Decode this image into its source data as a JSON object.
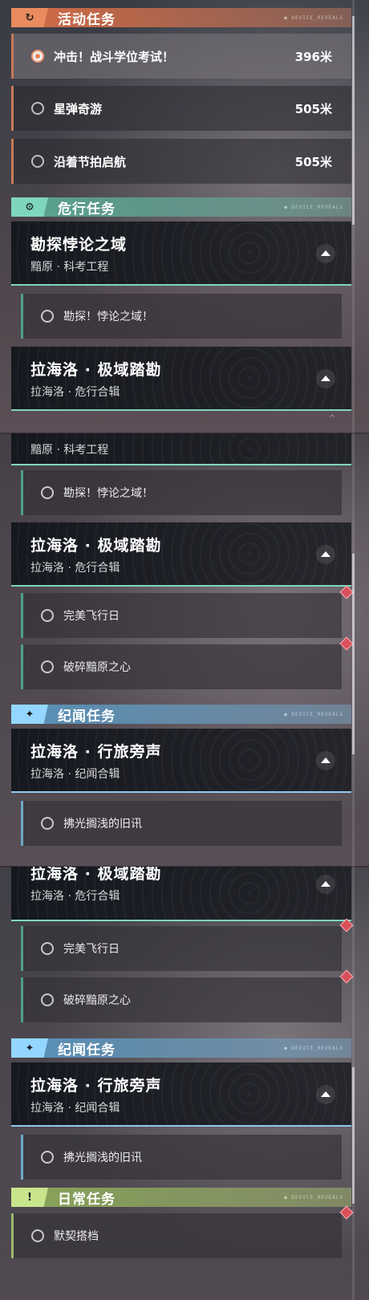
{
  "panel1": {
    "activity_header": {
      "title": "活动任务",
      "tag": "● DEVICE_REVEALS",
      "icon": "refresh-arrow-icon"
    },
    "activity_items": [
      {
        "label": "冲击！战斗学位考试！",
        "distance": "396米",
        "active": true
      },
      {
        "label": "星弹奇游",
        "distance": "505米",
        "active": false
      },
      {
        "label": "沿着节拍启航",
        "distance": "505米",
        "active": false
      }
    ],
    "danger_header": {
      "title": "危行任务",
      "tag": "● DEVICE_REVEALS",
      "icon": "gear-icon"
    },
    "card1": {
      "title": "勘探悖论之域",
      "subtitle": "黯原 · 科考工程"
    },
    "card1_sub": "勘探！悖论之域！",
    "card2": {
      "title": "拉海洛 · 极域踏勘",
      "subtitle": "拉海洛 · 危行合辑"
    },
    "scroll_hint": "^"
  },
  "panel2": {
    "card1_partial": {
      "subtitle": "黯原 · 科考工程"
    },
    "card1_sub": "勘探！悖论之域！",
    "card2": {
      "title": "拉海洛 · 极域踏勘",
      "subtitle": "拉海洛 · 危行合辑"
    },
    "card2_subs": [
      "完美飞行日",
      "破碎黯原之心"
    ],
    "story_header": {
      "title": "纪闻任务",
      "tag": "● DEVICE_REVEALS",
      "icon": "sparkle-icon"
    },
    "card3": {
      "title": "拉海洛 · 行旅旁声",
      "subtitle": "拉海洛 · 纪闻合辑"
    },
    "card3_sub": "拂光搁浅的旧讯"
  },
  "panel3": {
    "card2": {
      "title": "拉海洛 · 极域踏勘",
      "subtitle": "拉海洛 · 危行合辑"
    },
    "card2_subs": [
      "完美飞行日",
      "破碎黯原之心"
    ],
    "story_header": {
      "title": "纪闻任务",
      "tag": "● DEVICE_REVEALS",
      "icon": "sparkle-icon"
    },
    "card3": {
      "title": "拉海洛 · 行旅旁声",
      "subtitle": "拉海洛 · 纪闻合辑"
    },
    "card3_sub": "拂光搁浅的旧讯",
    "daily_header": {
      "title": "日常任务",
      "tag": "● DEVICE_REVEALS",
      "icon": "exclamation-icon"
    },
    "daily_item": "默契搭档"
  }
}
